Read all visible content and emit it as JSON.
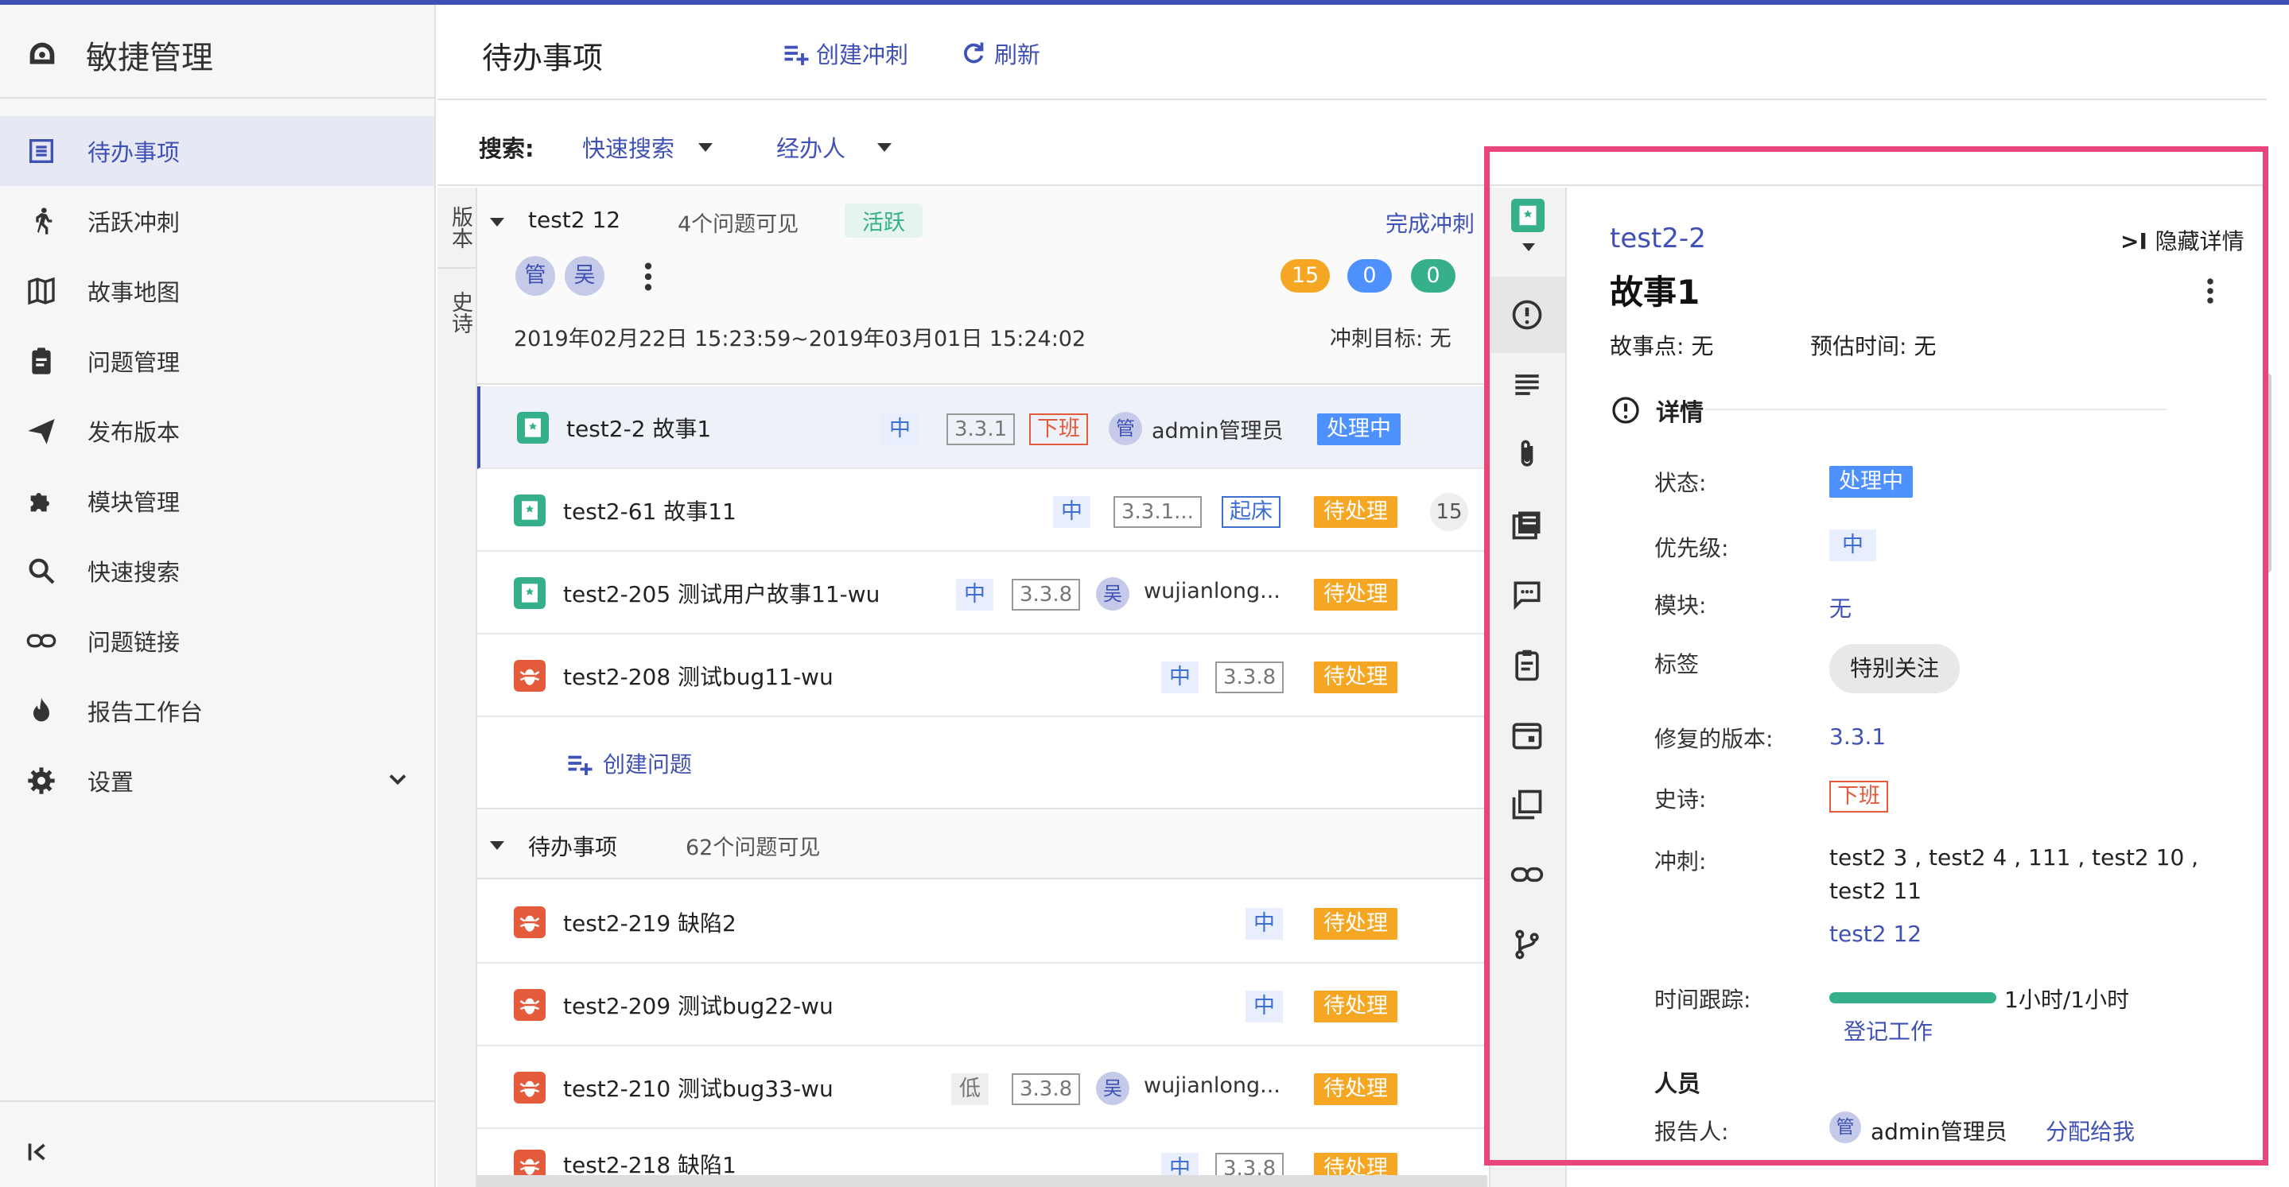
{
  "app": {
    "title": "敏捷管理"
  },
  "sidebar": {
    "items": [
      {
        "label": "待办事项",
        "icon": "backlog-icon"
      },
      {
        "label": "活跃冲刺",
        "icon": "running-icon"
      },
      {
        "label": "故事地图",
        "icon": "map-icon"
      },
      {
        "label": "问题管理",
        "icon": "clipboard-icon"
      },
      {
        "label": "发布版本",
        "icon": "send-icon"
      },
      {
        "label": "模块管理",
        "icon": "puzzle-icon"
      },
      {
        "label": "快速搜索",
        "icon": "search-icon"
      },
      {
        "label": "问题链接",
        "icon": "link-icon"
      },
      {
        "label": "报告工作台",
        "icon": "fire-icon"
      },
      {
        "label": "设置",
        "icon": "gear-icon"
      }
    ]
  },
  "header": {
    "title": "待办事项",
    "create_sprint": "创建冲刺",
    "refresh": "刷新"
  },
  "search": {
    "label": "搜索:",
    "quick": "快速搜索",
    "assignee": "经办人"
  },
  "vtabs": {
    "version": "版本",
    "epic": "史诗"
  },
  "sprint": {
    "name": "test2 12",
    "count": "4个问题可见",
    "status": "活跃",
    "complete": "完成冲刺",
    "avatars": [
      "管",
      "吴"
    ],
    "pills": [
      "15",
      "0",
      "0"
    ],
    "dates": "2019年02月22日 15:23:59~2019年03月01日 15:24:02",
    "goal": "冲刺目标: 无",
    "issues": [
      {
        "summary": "test2-2 故事1",
        "type": "story",
        "priority": "中",
        "version": "3.3.1",
        "epic": "下班",
        "avatar": "管",
        "assignee": "admin管理员",
        "status": "处理中"
      },
      {
        "summary": "test2-61 故事11",
        "type": "story",
        "priority": "中",
        "version": "3.3.1...",
        "epic": "起床",
        "status": "待处理",
        "points": "15"
      },
      {
        "summary": "test2-205 测试用户故事11-wu",
        "type": "story",
        "priority": "中",
        "version": "3.3.8",
        "avatar": "吴",
        "assignee": "wujianlong...",
        "status": "待处理"
      },
      {
        "summary": "test2-208 测试bug11-wu",
        "type": "bug",
        "priority": "中",
        "version": "3.3.8",
        "status": "待处理"
      }
    ],
    "create_issue": "创建问题"
  },
  "backlog": {
    "name": "待办事项",
    "count": "62个问题可见",
    "issues": [
      {
        "summary": "test2-219 缺陷2",
        "priority": "中",
        "status": "待处理"
      },
      {
        "summary": "test2-209 测试bug22-wu",
        "priority": "中",
        "status": "待处理"
      },
      {
        "summary": "test2-210 测试bug33-wu",
        "priority": "低",
        "version": "3.3.8",
        "avatar": "吴",
        "assignee": "wujianlong...",
        "status": "待处理"
      },
      {
        "summary": "test2-218 缺陷1",
        "priority": "中",
        "version": "3.3.8",
        "status": "待处理"
      }
    ]
  },
  "detail": {
    "key": "test2-2",
    "hide": "隐藏详情",
    "title": "故事1",
    "story_points": "故事点: 无",
    "estimate": "预估时间: 无",
    "section": "详情",
    "fields": {
      "status_label": "状态:",
      "status": "处理中",
      "priority_label": "优先级:",
      "priority": "中",
      "module_label": "模块:",
      "module": "无",
      "tag_label": "标签",
      "tag": "特别关注",
      "fix_version_label": "修复的版本:",
      "fix_version": "3.3.1",
      "epic_label": "史诗:",
      "epic": "下班",
      "sprint_label": "冲刺:",
      "sprint_line1": "test2 3 , test2 4 , 111 , test2 10 ,",
      "sprint_line2": "test2 11",
      "sprint_active": "test2 12",
      "time_label": "时间跟踪:",
      "time_value": "1小时/1小时",
      "time_progress": 1.0,
      "log_work": "登记工作",
      "people": "人员",
      "reporter_label": "报告人:",
      "reporter_avatar": "管",
      "reporter": "admin管理员",
      "assign_me": "分配给我"
    }
  },
  "colors": {
    "accent": "#3f51b5",
    "highlight": "#e8457a",
    "todo": "#f5a623",
    "doing": "#4d90fe",
    "green": "#35b08a",
    "red": "#e35b3a"
  }
}
